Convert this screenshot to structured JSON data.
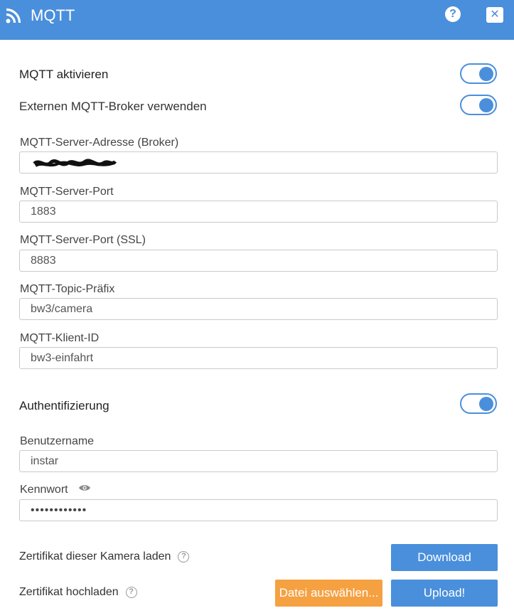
{
  "header": {
    "title": "MQTT",
    "help_label": "?",
    "close_label": "✕"
  },
  "settings": {
    "mqtt_enable_label": "MQTT aktivieren",
    "mqtt_enable": true,
    "external_broker_label": "Externen MQTT-Broker verwenden",
    "external_broker": true
  },
  "fields": {
    "server_address": {
      "label": "MQTT-Server-Adresse (Broker)",
      "value": ""
    },
    "server_port": {
      "label": "MQTT-Server-Port",
      "value": "1883"
    },
    "server_port_ssl": {
      "label": "MQTT-Server-Port (SSL)",
      "value": "8883"
    },
    "topic_prefix": {
      "label": "MQTT-Topic-Präfix",
      "value": "bw3/camera"
    },
    "client_id": {
      "label": "MQTT-Klient-ID",
      "value": "bw3-einfahrt"
    }
  },
  "auth": {
    "label": "Authentifizierung",
    "enabled": true,
    "username_label": "Benutzername",
    "username": "instar",
    "password_label": "Kennwort",
    "password": "••••••••••••"
  },
  "certificate": {
    "load_label": "Zertifikat dieser Kamera laden",
    "download_button": "Download",
    "upload_label": "Zertifikat hochladen",
    "choose_file_button": "Datei auswählen...",
    "upload_button": "Upload!"
  },
  "colors": {
    "accent": "#4a8fdb",
    "orange": "#f5a142"
  }
}
